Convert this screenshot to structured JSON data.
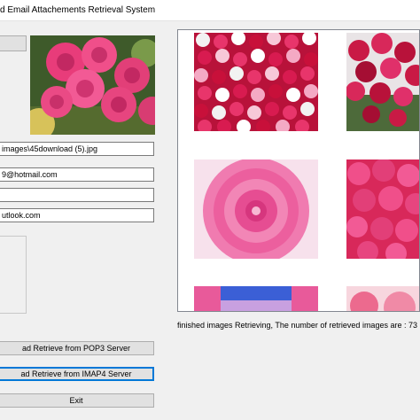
{
  "window": {
    "title": "d Email Attachements Retrieval System"
  },
  "form": {
    "image_path": "images\\45download (5).jpg",
    "email_address": "9@hotmail.com",
    "password": "",
    "server": "utlook.com"
  },
  "buttons": {
    "top_label": "",
    "pop3_label": "ad Retrieve from POP3 Server",
    "imap4_label": "ad Retrieve from IMAP4 Server",
    "exit_label": "Exit"
  },
  "status": {
    "message": "finished images Retrieving, The number of retrieved images are : 73"
  },
  "colors": {
    "window_bg": "#f0f0f0",
    "button_bg": "#e1e1e1",
    "focus_border": "#0078d7",
    "panel_border": "#828790"
  },
  "gallery": {
    "images": [
      "pink-red-white-roses",
      "dark-red-rose-bouquet",
      "pink-dahlia",
      "pink-rose-wall",
      "blue-pink-cut-off",
      "pink-rose-cut-off"
    ]
  }
}
